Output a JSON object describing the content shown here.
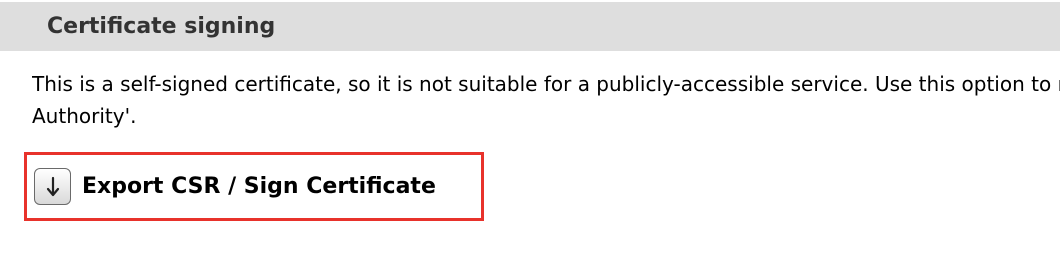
{
  "section": {
    "title": "Certificate signing"
  },
  "description": {
    "line1": "This is a self-signed certificate, so it is not suitable for a publicly-accessible service. Use this option to request it to be signed by a 'Certificate",
    "line2": "Authority'."
  },
  "export_button": {
    "label": "Export CSR / Sign Certificate",
    "icon": "arrow-down-icon",
    "highlight_color": "#e8322b"
  }
}
